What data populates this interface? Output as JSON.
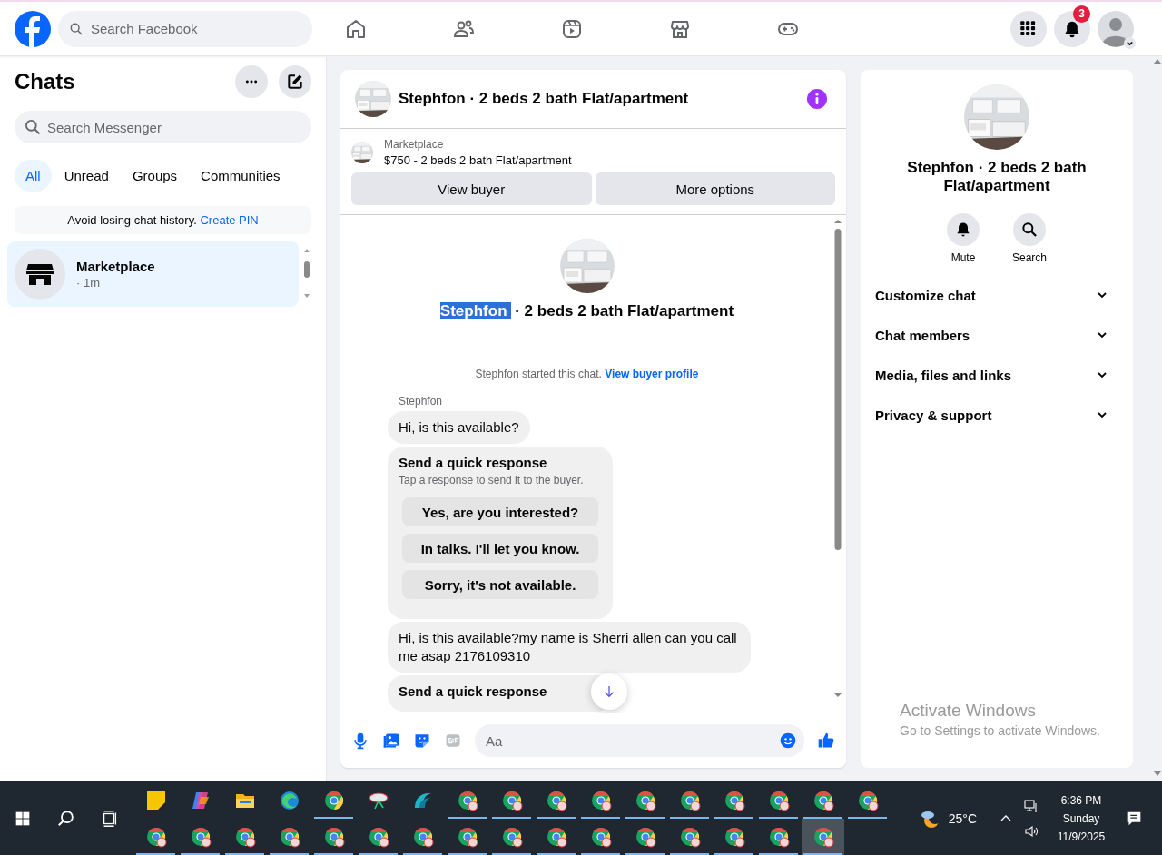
{
  "top_nav": {
    "search_placeholder": "Search Facebook",
    "notification_count": "3"
  },
  "chats_panel": {
    "title": "Chats",
    "search_placeholder": "Search Messenger",
    "filters": [
      {
        "label": "All",
        "selected": true
      },
      {
        "label": "Unread",
        "selected": false
      },
      {
        "label": "Groups",
        "selected": false
      },
      {
        "label": "Communities",
        "selected": false
      }
    ],
    "pin_notice": {
      "text": "Avoid losing chat history.",
      "link": "Create PIN"
    },
    "conversations": [
      {
        "name": "Marketplace",
        "time": "· 1m",
        "selected": true
      }
    ]
  },
  "conversation": {
    "title": "Stephfon · 2 beds 2 bath Flat/apartment",
    "listing": {
      "source": "Marketplace",
      "summary": "$750 - 2 beds 2 bath Flat/apartment"
    },
    "actions": [
      "View buyer",
      "More options"
    ],
    "intro_title": [
      {
        "text": "Stephfon",
        "selected": true
      },
      {
        "text": " · 2 beds 2 bath Flat/apartment",
        "selected": false
      }
    ],
    "started_note": {
      "text": "Stephfon started this chat.",
      "link": "View buyer profile"
    },
    "messages": [
      {
        "kind": "sender",
        "text": "Stephfon"
      },
      {
        "kind": "text",
        "text": "Hi, is this available?"
      },
      {
        "kind": "quick_responses",
        "title": "Send a quick response",
        "subtitle": "Tap a response to send it to the buyer.",
        "options": [
          "Yes, are you interested?",
          "In talks. I'll let you know.",
          "Sorry, it's not available."
        ]
      },
      {
        "kind": "text",
        "text": "Hi, is this available?my name is Sherri allen can you call me asap 2176109310"
      },
      {
        "kind": "quick_responses",
        "title": "Send a quick response"
      }
    ],
    "composer_placeholder": "Aa"
  },
  "info_panel": {
    "title": "Stephfon · 2 beds 2 bath Flat/apartment",
    "actions": [
      {
        "kind": "mute",
        "label": "Mute"
      },
      {
        "kind": "search",
        "label": "Search"
      }
    ],
    "sections": [
      {
        "label": "Customize chat",
        "expanded": false
      },
      {
        "label": "Chat members",
        "expanded": false
      },
      {
        "label": "Media, files and links",
        "expanded": false
      },
      {
        "label": "Privacy & support",
        "expanded": false
      }
    ]
  },
  "os_notice": {
    "title": "Activate Windows",
    "text": "Go to Settings to activate Windows."
  },
  "taskbar": {
    "apps": [
      {
        "kind": "notes",
        "running": false,
        "selected": false
      },
      {
        "kind": "copilot",
        "running": false,
        "selected": false
      },
      {
        "kind": "folder",
        "running": false,
        "selected": false
      },
      {
        "kind": "edge",
        "running": false,
        "selected": false
      },
      {
        "kind": "chrome",
        "running": true,
        "selected": false
      },
      {
        "kind": "tool",
        "running": false,
        "selected": false
      },
      {
        "kind": "wave",
        "running": false,
        "selected": false
      },
      {
        "kind": "chrome_profile",
        "running": true,
        "selected": false
      },
      {
        "kind": "chrome_profile",
        "running": true,
        "selected": false
      },
      {
        "kind": "chrome_profile",
        "running": true,
        "selected": false
      },
      {
        "kind": "chrome_profile",
        "running": true,
        "selected": false
      },
      {
        "kind": "chrome_profile",
        "running": true,
        "selected": false
      },
      {
        "kind": "chrome_profile",
        "running": true,
        "selected": false
      },
      {
        "kind": "chrome_profile",
        "running": true,
        "selected": false
      },
      {
        "kind": "chrome_profile",
        "running": true,
        "selected": false
      },
      {
        "kind": "chrome_profile",
        "running": true,
        "selected": false
      },
      {
        "kind": "chrome_profile",
        "running": true,
        "selected": false
      },
      {
        "kind": "chrome_profile",
        "running": true,
        "selected": false
      },
      {
        "kind": "chrome_profile",
        "running": true,
        "selected": false
      },
      {
        "kind": "chrome_profile",
        "running": true,
        "selected": false
      },
      {
        "kind": "chrome_profile",
        "running": true,
        "selected": false
      },
      {
        "kind": "chrome_profile",
        "running": true,
        "selected": false
      },
      {
        "kind": "chrome_profile",
        "running": true,
        "selected": false
      },
      {
        "kind": "chrome_profile",
        "running": true,
        "selected": false
      },
      {
        "kind": "chrome_profile",
        "running": true,
        "selected": false
      },
      {
        "kind": "chrome_profile",
        "running": true,
        "selected": false
      },
      {
        "kind": "chrome_profile",
        "running": true,
        "selected": false
      },
      {
        "kind": "chrome_profile",
        "running": true,
        "selected": false
      },
      {
        "kind": "chrome_profile",
        "running": true,
        "selected": false
      },
      {
        "kind": "chrome_profile",
        "running": true,
        "selected": false
      },
      {
        "kind": "chrome_profile",
        "running": true,
        "selected": false
      },
      {
        "kind": "chrome_profile",
        "running": true,
        "selected": false
      },
      {
        "kind": "chrome_profile",
        "running": true,
        "selected": true
      }
    ],
    "temperature": "25°C",
    "time": "6:36 PM",
    "day": "Sunday",
    "date": "11/9/2025"
  }
}
